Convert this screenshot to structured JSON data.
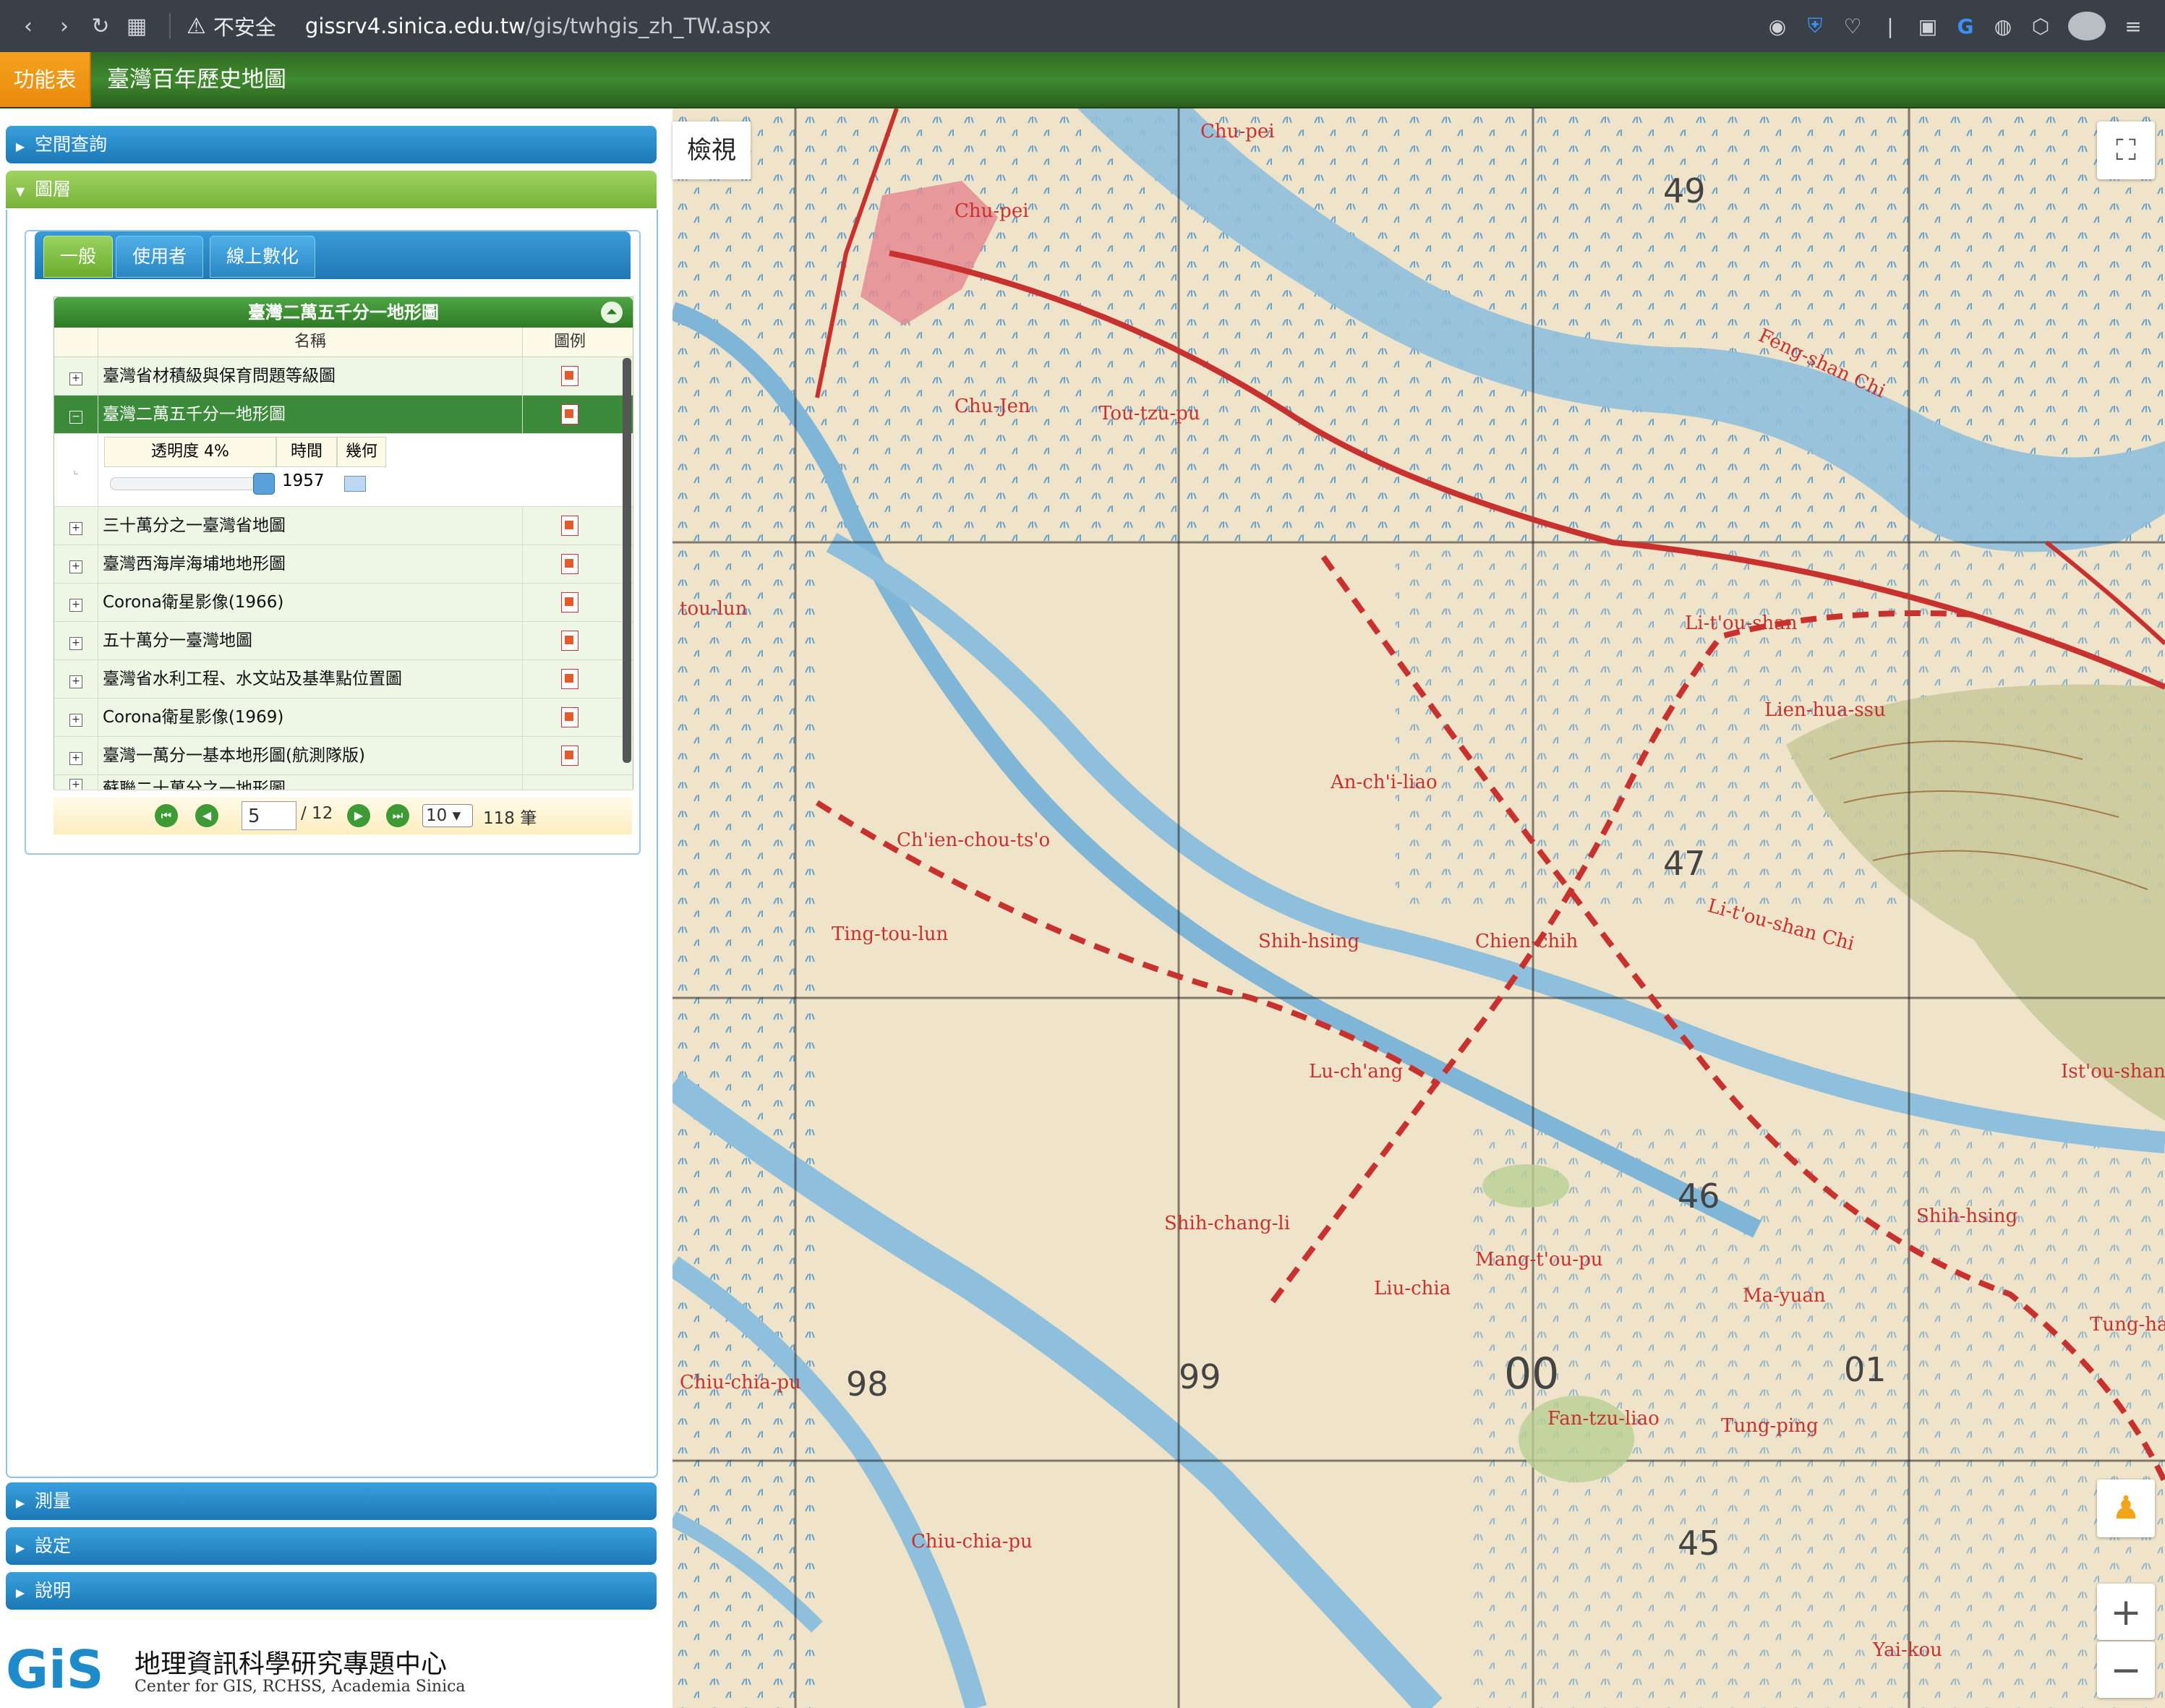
{
  "browser": {
    "insecure_label": "不安全",
    "url_host": "gissrv4.sinica.edu.tw",
    "url_path": "/gis/twhgis_zh_TW.aspx"
  },
  "app": {
    "menu_label": "功能表",
    "title": "臺灣百年歷史地圖"
  },
  "accordion": {
    "spatial_query": "空間查詢",
    "layers": "圖層",
    "measure": "測量",
    "settings": "設定",
    "help": "說明"
  },
  "tabs": [
    "一般",
    "使用者",
    "線上數化"
  ],
  "layer_grid": {
    "title": "臺灣二萬五千分一地形圖",
    "col_name": "名稱",
    "col_legend": "圖例",
    "rows": [
      "臺灣省材積級與保育問題等級圖",
      "臺灣二萬五千分一地形圖",
      "三十萬分之一臺灣省地圖",
      "臺灣西海岸海埔地地形圖",
      "Corona衛星影像(1966)",
      "五十萬分一臺灣地圖",
      "臺灣省水利工程、水文站及基準點位置圖",
      "Corona衛星影像(1969)",
      "臺灣一萬分一基本地形圖(航測隊版)",
      "蘇聯二十萬分之一地形圖"
    ],
    "expanded": {
      "opacity_label": "透明度 4%",
      "time_label": "時間",
      "geom_label": "幾何",
      "year": "1957",
      "opacity_value": 0.96
    },
    "pager": {
      "page": "5",
      "total_pages": "/ 12",
      "page_size": "10",
      "total_records": "118 筆"
    }
  },
  "logo": {
    "mark": "GiS",
    "name_zh": "地理資訊科學研究專題中心",
    "name_en": "Center for GIS, RCHSS, Academia Sinica"
  },
  "map": {
    "view_label": "檢視",
    "grid_labels": [
      "49",
      "47",
      "46",
      "45",
      "98",
      "99",
      "00",
      "01"
    ],
    "place_labels": [
      "Chu-pei",
      "Chu-Jen",
      "Tou-tzu-pu",
      "Feng-shan Chi",
      "Li-t'ou-shan",
      "Lien-hua-ssu",
      "An-ch'i-liao",
      "Ch'ien-chou-ts'o",
      "Ting-tou-lun",
      "Shih-hsing",
      "Chien-chih",
      "Lu-ch'ang",
      "Li-t'ou-shan Chi",
      "Shih-chang-li",
      "Mang-t'ou-pu",
      "Liu-chia",
      "Ma-yuan",
      "Tung-hai",
      "Tung-ping",
      "Fan-tzu-liao",
      "Chiu-chia-pu",
      "Yai-kou",
      "tou-lun",
      "Shih-hsing",
      "Chiu-chia-pu",
      "Ist'ou-shan"
    ],
    "zoom_in": "+",
    "zoom_out": "−"
  },
  "colors": {
    "header_green": "#3f8a2f",
    "menu_orange": "#f4a21c",
    "accordion_blue": "#1b78b6",
    "map_paper": "#efe3c9",
    "river_blue": "#8ebfdc",
    "road_red": "#c9312f"
  }
}
